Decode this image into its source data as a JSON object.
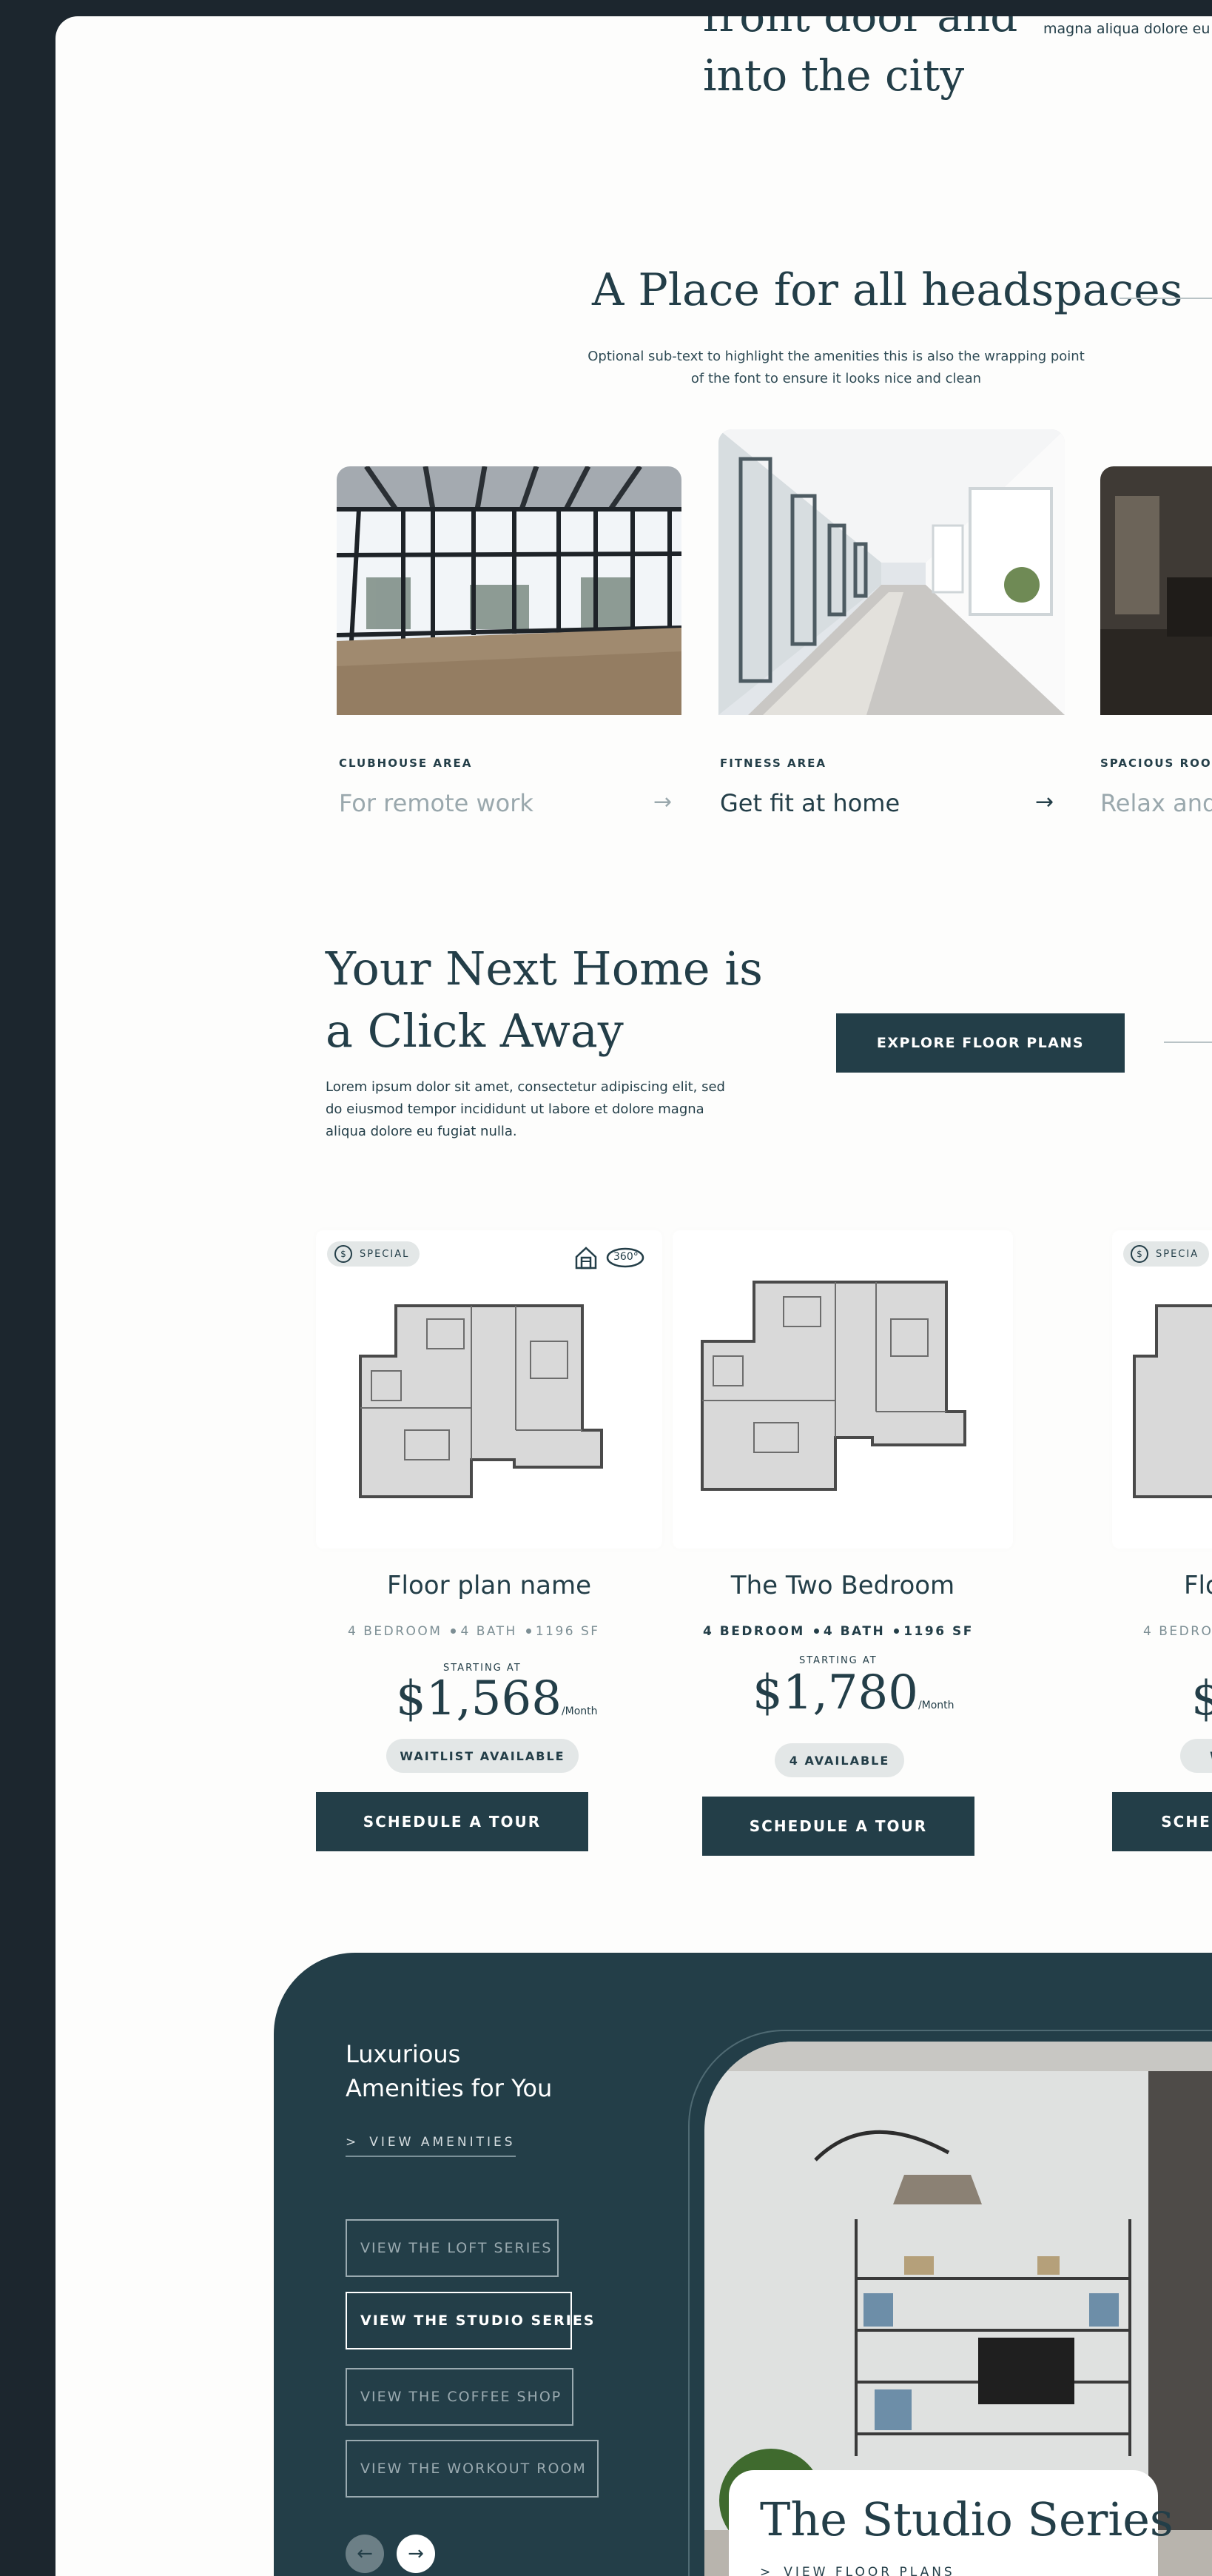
{
  "hero": {
    "title_line1": "front door and",
    "title_line2": "into the city",
    "side_text": "magna aliqua dolore eu fu"
  },
  "amenities": {
    "title": "A Place for all headspaces",
    "subtitle": "Optional sub-text to highlight the amenities this is also the wrapping point of the font to ensure it looks nice and clean",
    "cards": [
      {
        "category": "CLUBHOUSE AREA",
        "title": "For remote work",
        "arrow": "→"
      },
      {
        "category": "FITNESS AREA",
        "title": "Get fit at home",
        "arrow": "→"
      },
      {
        "category": "SPACIOUS ROO",
        "title": "Relax and"
      }
    ]
  },
  "next_home": {
    "title": "Your Next Home is a Click Away",
    "body": "Lorem ipsum dolor sit amet, consectetur adipiscing elit, sed do eiusmod tempor incididunt ut labore et dolore magna aliqua dolore eu fugiat nulla.",
    "button": "EXPLORE FLOOR PLANS"
  },
  "floor_plans": [
    {
      "badge": "SPECIAL",
      "badge_icon": "$",
      "icon_360": "360°",
      "name": "Floor plan name",
      "bed": "4 BEDROOM",
      "bath": "4 BATH",
      "sf": "1196 SF",
      "starting": "STARTING AT",
      "price": "$1,568",
      "per": "/Month",
      "status": "WAITLIST AVAILABLE",
      "cta": "SCHEDULE A TOUR"
    },
    {
      "name": "The Two Bedroom",
      "bed": "4 BEDROOM",
      "bath": "4 BATH",
      "sf": "1196 SF",
      "starting": "STARTING AT",
      "price": "$1,780",
      "per": "/Month",
      "status": "4 AVAILABLE",
      "cta": "SCHEDULE A TOUR"
    },
    {
      "badge": "SPECIA",
      "badge_icon": "$",
      "name": "Flo",
      "bed": "4 BEDRO",
      "price": "$",
      "status": "W",
      "cta": "SCHE"
    }
  ],
  "amenity_series": {
    "title_line1": "Luxurious",
    "title_line2": "Amenities for You",
    "view_link": "VIEW AMENITIES",
    "buttons": [
      "VIEW THE LOFT SERIES",
      "VIEW THE STUDIO SERIES",
      "VIEW THE COFFEE SHOP",
      "VIEW THE WORKOUT ROOM"
    ],
    "active_index": 1,
    "prev": "←",
    "next": "→",
    "feature_title": "The Studio Series",
    "feature_link": "VIEW FLOOR PLANS"
  },
  "colors": {
    "primary": "#233e48",
    "background": "#fdfdfc",
    "frame": "#1c262e",
    "pill": "#e3e7e7"
  }
}
